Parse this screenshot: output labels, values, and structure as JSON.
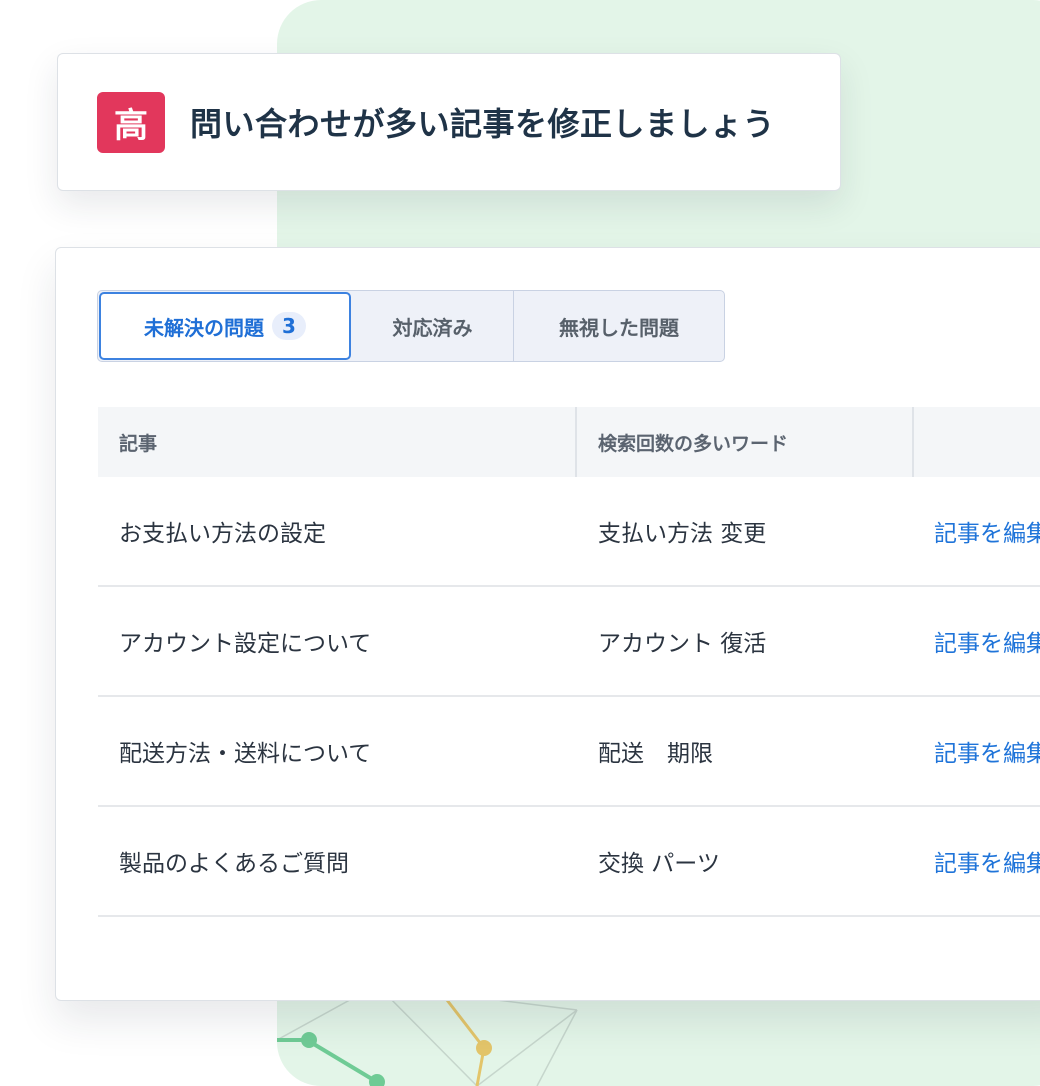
{
  "header": {
    "priority_label": "高",
    "title": "問い合わせが多い記事を修正しましょう"
  },
  "tabs": [
    {
      "label": "未解決の問題",
      "count": "3",
      "active": true
    },
    {
      "label": "対応済み",
      "active": false
    },
    {
      "label": "無視した問題",
      "active": false
    }
  ],
  "table": {
    "columns": [
      "記事",
      "検索回数の多いワード",
      ""
    ],
    "rows": [
      {
        "article": "お支払い方法の設定",
        "keywords": "支払い方法 変更",
        "action": "記事を編集"
      },
      {
        "article": "アカウント設定について",
        "keywords": "アカウント 復活",
        "action": "記事を編集"
      },
      {
        "article": "配送方法・送料について",
        "keywords": "配送　期限",
        "action": "記事を編集"
      },
      {
        "article": "製品のよくあるご質問",
        "keywords": "交換 パーツ",
        "action": "記事を編集"
      }
    ]
  },
  "colors": {
    "priority_badge": "#e2375c",
    "accent_blue": "#1f74d9",
    "backdrop_green": "#e3f5e8"
  }
}
